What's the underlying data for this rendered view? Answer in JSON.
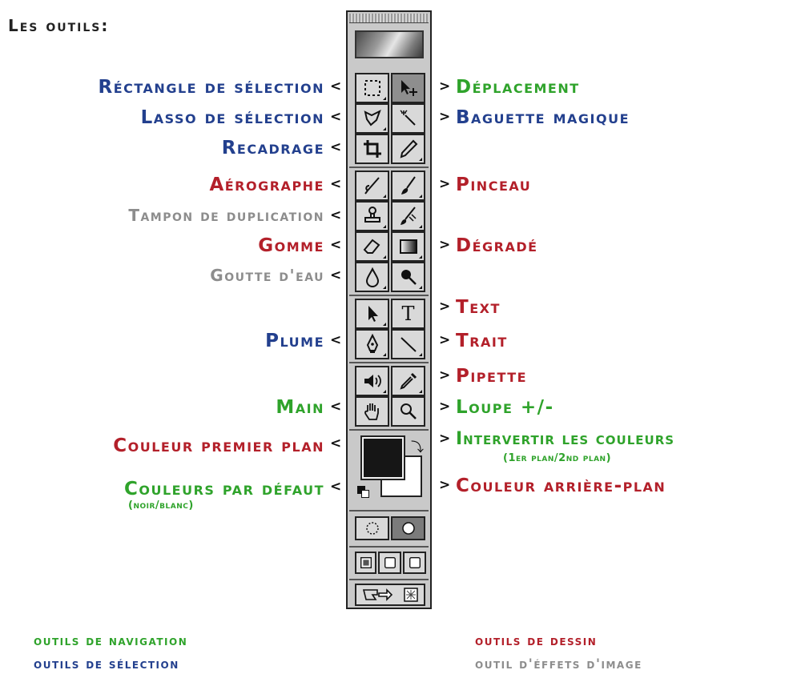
{
  "title": "Les outils:",
  "colors": {
    "selection": "#23408e",
    "navigation": "#2fa32b",
    "drawing": "#b3202a",
    "image_effects": "#8d8d8d"
  },
  "labels_left": {
    "rectangle": "Réctangle de sélection",
    "lasso": "Lasso de sélection",
    "recadrage": "Recadrage",
    "aerographe": "Aérographe",
    "tampon": "Tampon de duplication",
    "gomme": "Gomme",
    "goutte": "Goutte d'eau",
    "plume": "Plume",
    "main": "Main",
    "couleur_pp": "Couleur premier plan",
    "couleurs_defaut": "Couleurs par défaut",
    "couleurs_defaut_sub": "(noir/blanc)"
  },
  "labels_right": {
    "deplacement": "Déplacement",
    "baguette": "Baguette magique",
    "pinceau": "Pinceau",
    "degrade": "Dégradé",
    "text": "Text",
    "trait": "Trait",
    "pipette": "Pipette",
    "loupe": "Loupe +/-",
    "intervertir": "Intervertir les couleurs",
    "intervertir_sub": "(1er plan/2nd plan)",
    "couleur_ap": "Couleur arrière-plan"
  },
  "arrows": {
    "left": "<",
    "right": ">"
  },
  "legend": {
    "navigation": "outils de navigation",
    "selection": "outils de sélection",
    "dessin": "outils de dessin",
    "effets": "outil d'éffets d'image"
  },
  "tools": {
    "text_glyph": "T",
    "swap_glyph": "⤵"
  }
}
